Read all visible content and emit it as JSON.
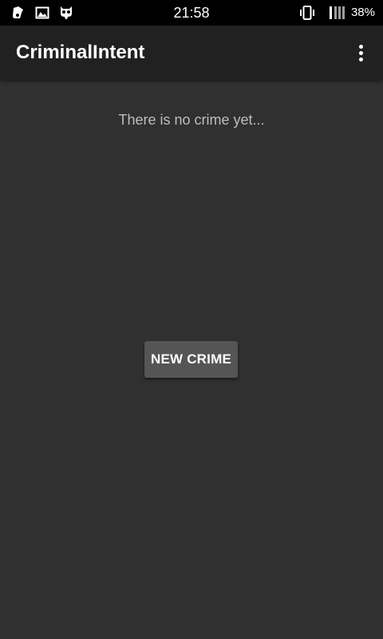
{
  "status_bar": {
    "time": "21:58",
    "battery": "38%",
    "icons_left": [
      "notification-icon",
      "image-icon",
      "cat-icon"
    ],
    "icons_right": [
      "vibrate-icon",
      "signal-icon"
    ]
  },
  "app_bar": {
    "title": "CriminalIntent",
    "overflow_icon": "more-vert-icon"
  },
  "content": {
    "empty_message": "There is no crime yet...",
    "new_crime_button": "NEW CRIME"
  },
  "colors": {
    "background": "#303030",
    "app_bar": "#212121",
    "button": "#555555",
    "message_text": "#bdbdbd"
  }
}
